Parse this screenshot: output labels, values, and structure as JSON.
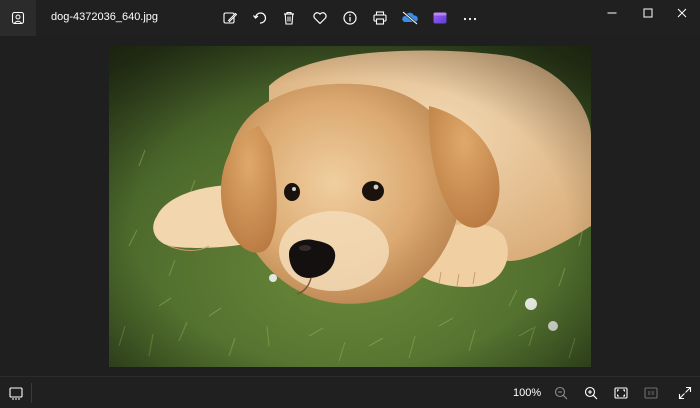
{
  "window": {
    "file_name": "dog-4372036_640.jpg"
  },
  "toolbar": {
    "icons": [
      "edit-image-icon",
      "rotate-icon",
      "delete-icon",
      "favorite-heart-icon",
      "file-info-icon",
      "print-icon",
      "onedrive-sync-off-icon",
      "clipchamp-icon",
      "more-options-icon"
    ]
  },
  "window_controls": [
    "minimize-icon",
    "maximize-icon",
    "close-icon"
  ],
  "bottom_bar": {
    "zoom_level": "100%",
    "icons": [
      "filmstrip-icon",
      "zoom-out-icon",
      "zoom-in-icon",
      "fit-to-window-icon",
      "actual-size-icon",
      "fullscreen-icon"
    ]
  },
  "colors": {
    "background": "#1f1f1f",
    "toolbar": "#202020",
    "onedrive_accent": "#3b8ee8",
    "clipchamp_accent": "#8b4ee0"
  }
}
